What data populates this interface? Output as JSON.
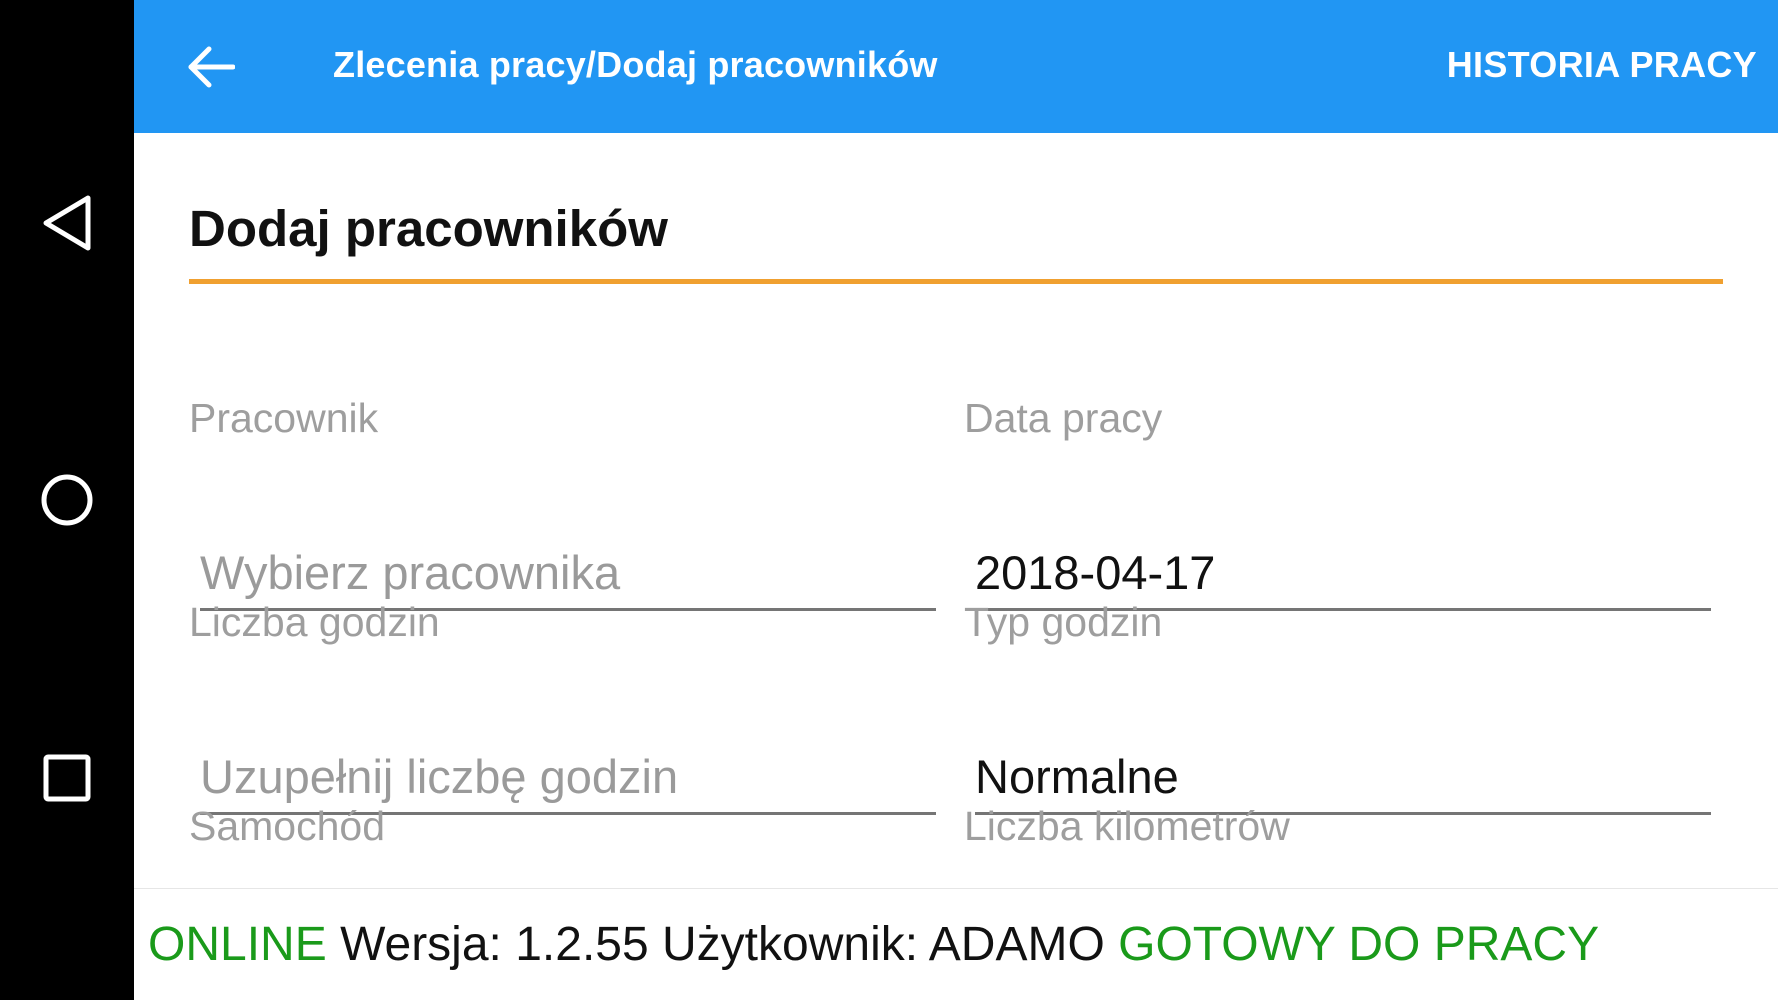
{
  "navbar": {
    "back_icon": "triangle-back-icon",
    "home_icon": "circle-home-icon",
    "recent_icon": "square-recents-icon"
  },
  "appbar": {
    "back_icon": "arrow-left-icon",
    "title": "Zlecenia pracy/Dodaj pracowników",
    "action_label": "HISTORIA PRACY",
    "background_color": "#2196f3"
  },
  "form": {
    "section_title": "Dodaj pracowników",
    "accent_color": "#f0a030",
    "fields": {
      "worker": {
        "label": "Pracownik",
        "placeholder": "Wybierz pracownika",
        "value": ""
      },
      "work_date": {
        "label": "Data pracy",
        "value": "2018-04-17"
      },
      "hours": {
        "label": "Liczba godzin",
        "placeholder": "Uzupełnij liczbę godzin",
        "value": ""
      },
      "hours_type": {
        "label": "Typ godzin",
        "value": "Normalne"
      },
      "car": {
        "label": "Samochód"
      },
      "kilometers": {
        "label": "Liczba kilometrów"
      }
    }
  },
  "status": {
    "connection": "ONLINE",
    "version_label": "Wersja:",
    "version": "1.2.55",
    "user_label": "Użytkownik:",
    "user": "ADAMO",
    "state": "GOTOWY DO PRACY",
    "green_color": "#1a9a1a"
  }
}
